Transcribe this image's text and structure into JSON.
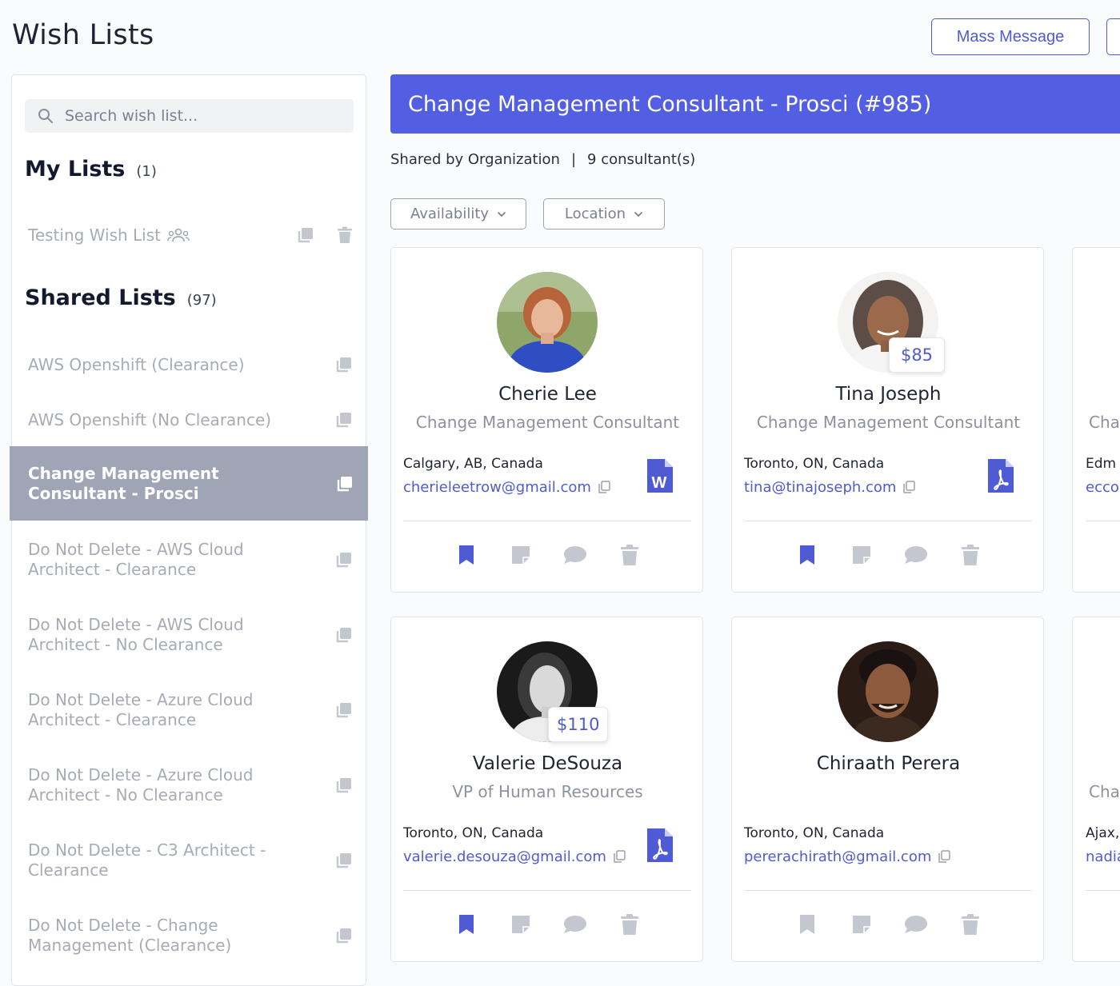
{
  "page": {
    "title": "Wish Lists",
    "mass_message_label": "Mass Message"
  },
  "sidebar": {
    "search_placeholder": "Search wish list...",
    "my_lists": {
      "heading": "My Lists",
      "count": "(1)",
      "items": [
        {
          "label": "Testing Wish List"
        }
      ]
    },
    "shared_lists": {
      "heading": "Shared Lists",
      "count": "(97)",
      "items": [
        {
          "label": "AWS Openshift (Clearance)"
        },
        {
          "label": "AWS Openshift (No Clearance)"
        },
        {
          "label": "Change Management Consultant - Prosci",
          "active": true
        },
        {
          "label": "Do Not Delete - AWS Cloud Architect - Clearance"
        },
        {
          "label": "Do Not Delete - AWS Cloud Architect - No Clearance"
        },
        {
          "label": "Do Not Delete - Azure Cloud Architect - Clearance"
        },
        {
          "label": "Do Not Delete - Azure Cloud Architect - No Clearance"
        },
        {
          "label": "Do Not Delete - C3 Architect - Clearance"
        },
        {
          "label": "Do Not Delete - Change Management (Clearance)"
        }
      ]
    }
  },
  "main": {
    "banner_title": "Change Management Consultant - Prosci (#985)",
    "shared_by": "Shared by Organization",
    "consultant_count": "9 consultant(s)",
    "filters": [
      {
        "label": "Availability"
      },
      {
        "label": "Location"
      }
    ],
    "consultants": [
      {
        "name": "Cherie Lee",
        "title": "Change Management Consultant",
        "location": "Calgary, AB, Canada",
        "email": "cherieleetrow@gmail.com",
        "rate": "",
        "doc_type": "word-doc-icon",
        "bookmarked": true
      },
      {
        "name": "Tina Joseph",
        "title": "Change Management Consultant",
        "location": "Toronto, ON, Canada",
        "email": "tina@tinajoseph.com",
        "rate": "$85",
        "doc_type": "pdf-doc-icon",
        "bookmarked": true
      },
      {
        "name": "Valerie DeSouza",
        "title": "VP of Human Resources",
        "location": "Toronto, ON, Canada",
        "email": "valerie.desouza@gmail.com",
        "rate": "$110",
        "doc_type": "pdf-doc-icon",
        "bookmarked": true
      },
      {
        "name": "Chiraath Perera",
        "title": "",
        "location": "Toronto, ON, Canada",
        "email": "pererachirath@gmail.com",
        "rate": "",
        "doc_type": "",
        "bookmarked": false
      }
    ],
    "partial_cards": [
      {
        "title": "Cha",
        "location": "Edm",
        "email": "eccol"
      },
      {
        "title": "Cha",
        "location": "Ajax,",
        "email": "nadia"
      }
    ]
  },
  "colors": {
    "accent": "#535fe3",
    "link": "#4f5bd5",
    "active_item": "#9fa5b4",
    "muted": "#a7abb6",
    "icon_grey": "#c4c7cf"
  }
}
